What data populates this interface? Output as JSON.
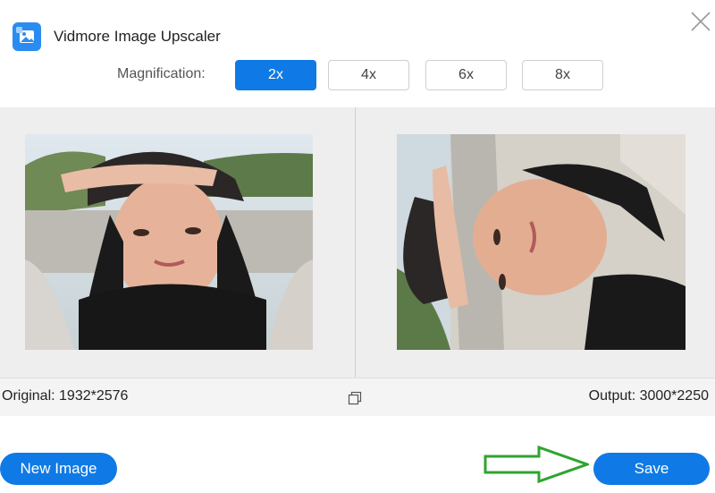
{
  "app": {
    "title": "Vidmore Image Upscaler",
    "logo_icon": "photo-app-icon",
    "accent": "#0f7ae5"
  },
  "magnification": {
    "label": "Magnification:",
    "options": [
      "2x",
      "4x",
      "6x",
      "8x"
    ],
    "selected": "2x"
  },
  "preview": {
    "original_label": "Original: 1932*2576",
    "output_label": "Output: 3000*2250"
  },
  "actions": {
    "new_image": "New Image",
    "save": "Save"
  },
  "annotation": {
    "arrow_color": "#2ea52e",
    "arrow_target": "save-button"
  }
}
